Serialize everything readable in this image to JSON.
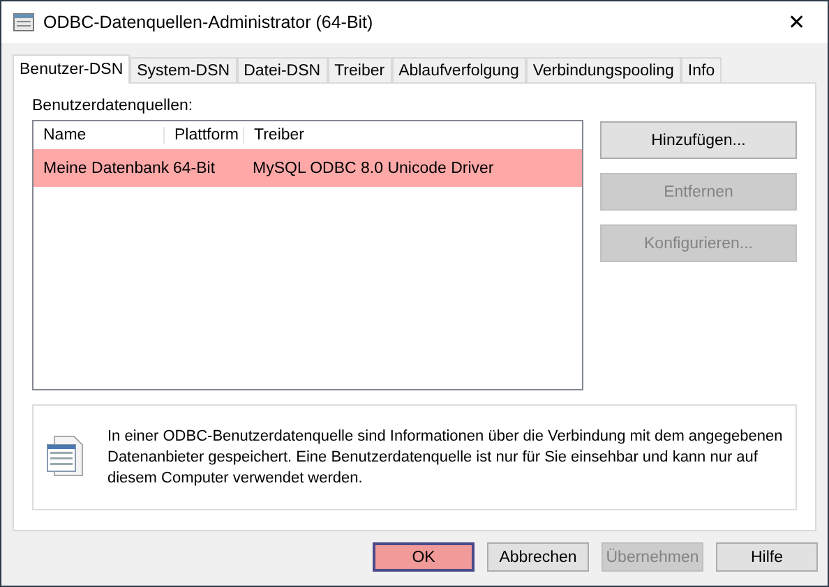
{
  "window": {
    "title": "ODBC-Datenquellen-Administrator (64-Bit)",
    "close": "✕"
  },
  "tabs": [
    {
      "label": "Benutzer-DSN",
      "selected": true
    },
    {
      "label": "System-DSN",
      "selected": false
    },
    {
      "label": "Datei-DSN",
      "selected": false
    },
    {
      "label": "Treiber",
      "selected": false
    },
    {
      "label": "Ablaufverfolgung",
      "selected": false
    },
    {
      "label": "Verbindungspooling",
      "selected": false
    },
    {
      "label": "Info",
      "selected": false
    }
  ],
  "list": {
    "label": "Benutzerdatenquellen:",
    "columns": [
      "Name",
      "Plattform",
      "Treiber"
    ],
    "rows": [
      {
        "cells": [
          "Meine Datenbank",
          "64-Bit",
          "MySQL ODBC 8.0 Unicode Driver"
        ],
        "selected": true
      }
    ]
  },
  "side_buttons": [
    {
      "label": "Hinzufügen...",
      "disabled": false
    },
    {
      "label": "Entfernen",
      "disabled": true
    },
    {
      "label": "Konfigurieren...",
      "disabled": true
    }
  ],
  "info": "In einer ODBC-Benutzerdatenquelle sind Informationen über die Verbindung mit dem angegebenen Datenanbieter gespeichert. Eine Benutzerdatenquelle ist nur für Sie einsehbar und kann nur auf diesem Computer verwendet werden.",
  "buttons": [
    {
      "label": "OK",
      "default": true,
      "disabled": false
    },
    {
      "label": "Abbrechen",
      "default": false,
      "disabled": false
    },
    {
      "label": "Übernehmen",
      "default": false,
      "disabled": true
    },
    {
      "label": "Hilfe",
      "default": false,
      "disabled": false
    }
  ]
}
